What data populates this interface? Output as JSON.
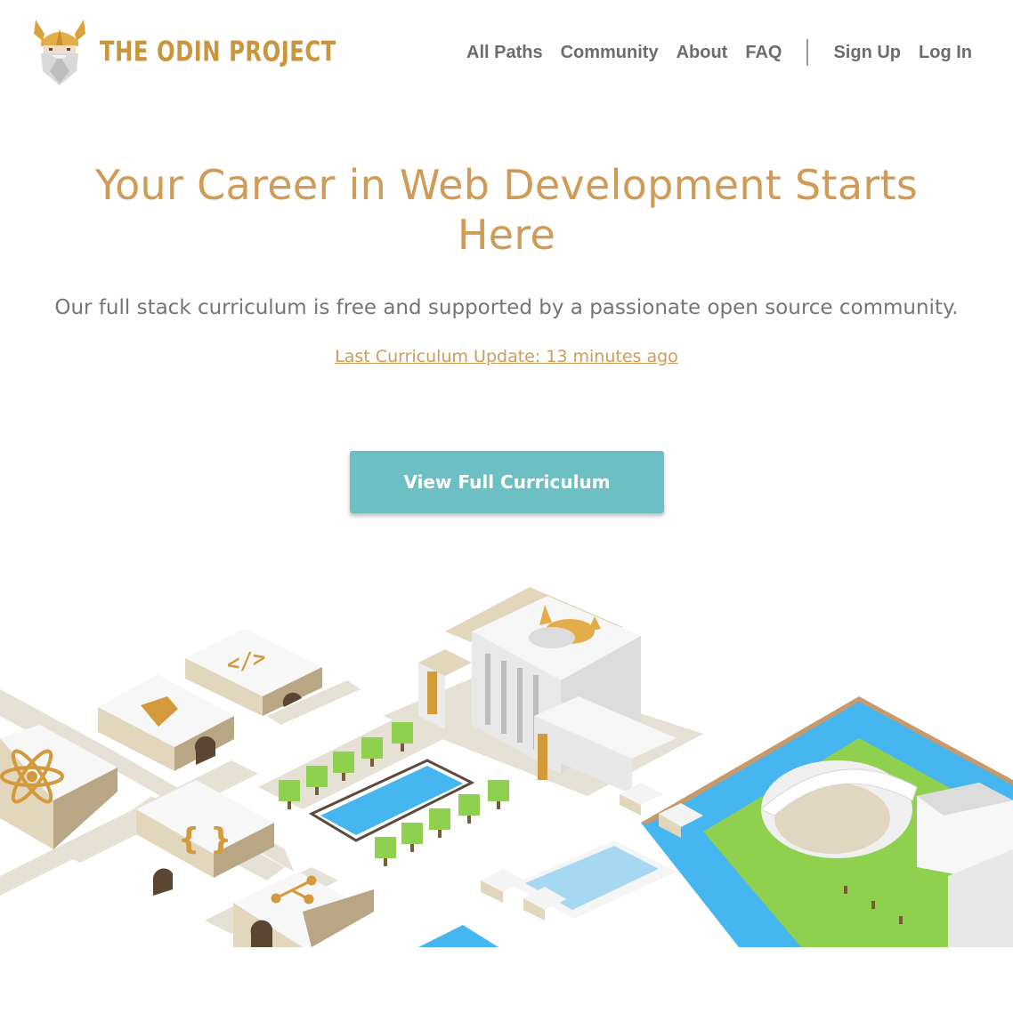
{
  "brand": {
    "name": "THE ODIN PROJECT"
  },
  "nav": {
    "links": [
      "All Paths",
      "Community",
      "About",
      "FAQ"
    ],
    "auth": [
      "Sign Up",
      "Log In"
    ]
  },
  "hero": {
    "title": "Your Career in Web Development Starts Here",
    "subtitle": "Our full stack curriculum is free and supported by a passionate open source community.",
    "update_link": "Last Curriculum Update: 13 minutes ago",
    "cta_label": "View Full Curriculum"
  },
  "illustration": {
    "building_icons": [
      "code-tag-icon",
      "gem-icon",
      "react-atom-icon",
      "curly-braces-icon",
      "git-branch-icon"
    ]
  },
  "colors": {
    "brand_gold": "#cf9b57",
    "teal_button": "#6cc0c3",
    "nav_text": "#6c6c6c",
    "water": "#45b6ef",
    "grass": "#8fd14f",
    "path": "#e6e1d5"
  }
}
